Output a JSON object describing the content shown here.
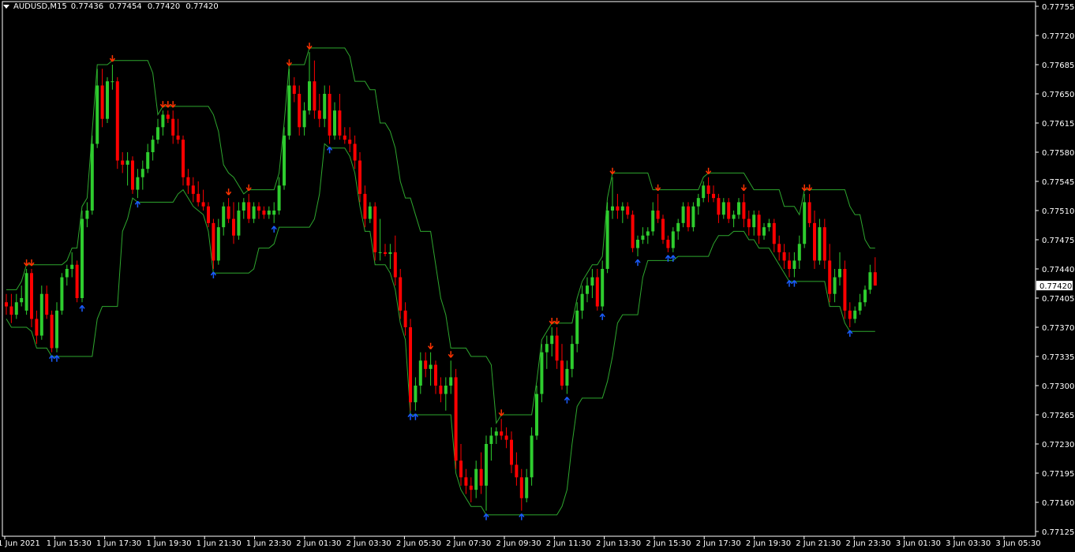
{
  "header": {
    "symbol": "AUDUSD,M15",
    "open": "0.77436",
    "high": "0.77454",
    "low": "0.77420",
    "close": "0.77420"
  },
  "current_price_label": "0.77420",
  "colors": {
    "background": "#000000",
    "bull": "#2ecc2e",
    "bear": "#ff0000",
    "envelope": "#2ea62e",
    "arrow_up": "#1a5cff",
    "arrow_down": "#ff3300",
    "price_tag_bg": "#ffffff",
    "axis": "#ffffff"
  },
  "chart_data": {
    "type": "candlestick",
    "ylim": [
      0.77125,
      0.77755
    ],
    "y_ticks": [
      "0.77755",
      "0.77720",
      "0.77685",
      "0.77650",
      "0.77615",
      "0.77580",
      "0.77545",
      "0.77510",
      "0.77475",
      "0.77440",
      "0.77405",
      "0.77370",
      "0.77335",
      "0.77300",
      "0.77265",
      "0.77230",
      "0.77195",
      "0.77160",
      "0.77125"
    ],
    "x_ticks": [
      "1 Jun 2021",
      "1 Jun 15:30",
      "1 Jun 17:30",
      "1 Jun 19:30",
      "1 Jun 21:30",
      "1 Jun 23:30",
      "2 Jun 01:30",
      "2 Jun 03:30",
      "2 Jun 05:30",
      "2 Jun 07:30",
      "2 Jun 09:30",
      "2 Jun 11:30",
      "2 Jun 13:30",
      "2 Jun 15:30",
      "2 Jun 17:30",
      "2 Jun 19:30",
      "2 Jun 21:30",
      "2 Jun 23:30",
      "3 Jun 01:30",
      "3 Jun 03:30",
      "3 Jun 05:30"
    ],
    "candle_step": 6.4,
    "candles": [
      [
        0.774,
        0.7741,
        0.77385,
        0.77395
      ],
      [
        0.77395,
        0.7741,
        0.77375,
        0.77385
      ],
      [
        0.77385,
        0.7741,
        0.7738,
        0.774
      ],
      [
        0.774,
        0.7742,
        0.77395,
        0.77405
      ],
      [
        0.7739,
        0.7744,
        0.77385,
        0.77435
      ],
      [
        0.77435,
        0.7744,
        0.7737,
        0.7738
      ],
      [
        0.7738,
        0.7739,
        0.7735,
        0.7736
      ],
      [
        0.7736,
        0.7742,
        0.77355,
        0.7741
      ],
      [
        0.7741,
        0.7742,
        0.7738,
        0.77385
      ],
      [
        0.77385,
        0.7739,
        0.7734,
        0.77345
      ],
      [
        0.77345,
        0.774,
        0.7734,
        0.7739
      ],
      [
        0.7739,
        0.77435,
        0.77385,
        0.7743
      ],
      [
        0.7743,
        0.77445,
        0.7742,
        0.7744
      ],
      [
        0.7744,
        0.7746,
        0.7743,
        0.77445
      ],
      [
        0.77445,
        0.7745,
        0.774,
        0.77405
      ],
      [
        0.77405,
        0.7751,
        0.774,
        0.775
      ],
      [
        0.775,
        0.7752,
        0.7749,
        0.7751
      ],
      [
        0.7751,
        0.776,
        0.77505,
        0.7759
      ],
      [
        0.7759,
        0.7768,
        0.77585,
        0.7766
      ],
      [
        0.7766,
        0.7768,
        0.7761,
        0.7762
      ],
      [
        0.7762,
        0.7767,
        0.77615,
        0.77665
      ],
      [
        0.77665,
        0.77685,
        0.77655,
        0.77665
      ],
      [
        0.77665,
        0.7767,
        0.7756,
        0.7757
      ],
      [
        0.7757,
        0.7758,
        0.77555,
        0.77565
      ],
      [
        0.77565,
        0.7758,
        0.7754,
        0.7757
      ],
      [
        0.7757,
        0.77575,
        0.7753,
        0.77535
      ],
      [
        0.77535,
        0.7756,
        0.77525,
        0.7755
      ],
      [
        0.7755,
        0.7757,
        0.77535,
        0.7756
      ],
      [
        0.7756,
        0.7759,
        0.77555,
        0.7758
      ],
      [
        0.7758,
        0.776,
        0.7757,
        0.77595
      ],
      [
        0.77595,
        0.7762,
        0.7759,
        0.7761
      ],
      [
        0.7761,
        0.7763,
        0.776,
        0.77625
      ],
      [
        0.77625,
        0.7763,
        0.77615,
        0.7762
      ],
      [
        0.7762,
        0.7763,
        0.7759,
        0.776
      ],
      [
        0.776,
        0.7762,
        0.7759,
        0.77595
      ],
      [
        0.77595,
        0.776,
        0.7754,
        0.7755
      ],
      [
        0.7755,
        0.7756,
        0.7753,
        0.7754
      ],
      [
        0.7754,
        0.7755,
        0.7752,
        0.7753
      ],
      [
        0.7753,
        0.77545,
        0.77515,
        0.7752
      ],
      [
        0.7752,
        0.77535,
        0.7751,
        0.77515
      ],
      [
        0.77515,
        0.7752,
        0.7749,
        0.77495
      ],
      [
        0.77495,
        0.775,
        0.7744,
        0.7745
      ],
      [
        0.7745,
        0.775,
        0.77445,
        0.7749
      ],
      [
        0.7749,
        0.7752,
        0.7748,
        0.77515
      ],
      [
        0.77515,
        0.77525,
        0.77495,
        0.775
      ],
      [
        0.775,
        0.7752,
        0.7747,
        0.7748
      ],
      [
        0.7748,
        0.7752,
        0.77475,
        0.7751
      ],
      [
        0.7751,
        0.77525,
        0.775,
        0.7752
      ],
      [
        0.7752,
        0.7753,
        0.77495,
        0.775
      ],
      [
        0.775,
        0.7752,
        0.77495,
        0.77515
      ],
      [
        0.77515,
        0.7752,
        0.775,
        0.7751
      ],
      [
        0.7751,
        0.77515,
        0.775,
        0.77505
      ],
      [
        0.77505,
        0.77515,
        0.775,
        0.7751
      ],
      [
        0.77505,
        0.7752,
        0.77495,
        0.7751
      ],
      [
        0.7751,
        0.7755,
        0.77505,
        0.7754
      ],
      [
        0.7754,
        0.7761,
        0.77535,
        0.776
      ],
      [
        0.776,
        0.7768,
        0.77595,
        0.7766
      ],
      [
        0.7766,
        0.7767,
        0.7764,
        0.7765
      ],
      [
        0.7765,
        0.7766,
        0.776,
        0.7761
      ],
      [
        0.7761,
        0.7764,
        0.776,
        0.7763
      ],
      [
        0.7763,
        0.777,
        0.77625,
        0.77665
      ],
      [
        0.77665,
        0.7769,
        0.7762,
        0.7763
      ],
      [
        0.7763,
        0.7765,
        0.7761,
        0.7762
      ],
      [
        0.7762,
        0.7766,
        0.7761,
        0.7765
      ],
      [
        0.7765,
        0.7766,
        0.7759,
        0.776
      ],
      [
        0.776,
        0.7764,
        0.77595,
        0.7763
      ],
      [
        0.7763,
        0.7765,
        0.77595,
        0.776
      ],
      [
        0.776,
        0.7761,
        0.7759,
        0.77595
      ],
      [
        0.77595,
        0.7761,
        0.7758,
        0.7759
      ],
      [
        0.7759,
        0.776,
        0.7756,
        0.7757
      ],
      [
        0.7757,
        0.7758,
        0.7752,
        0.7753
      ],
      [
        0.7753,
        0.7754,
        0.7749,
        0.775
      ],
      [
        0.775,
        0.7752,
        0.77495,
        0.77515
      ],
      [
        0.77515,
        0.7752,
        0.7745,
        0.7746
      ],
      [
        0.7746,
        0.775,
        0.7745,
        0.7746
      ],
      [
        0.7746,
        0.7747,
        0.77455,
        0.77458
      ],
      [
        0.77458,
        0.7747,
        0.7744,
        0.7746
      ],
      [
        0.7746,
        0.7748,
        0.7742,
        0.7743
      ],
      [
        0.7743,
        0.7744,
        0.7738,
        0.7739
      ],
      [
        0.7739,
        0.774,
        0.7736,
        0.7737
      ],
      [
        0.7737,
        0.7738,
        0.7727,
        0.7728
      ],
      [
        0.7728,
        0.7731,
        0.7727,
        0.773
      ],
      [
        0.773,
        0.7734,
        0.7729,
        0.7733
      ],
      [
        0.7733,
        0.7734,
        0.7731,
        0.7732
      ],
      [
        0.7732,
        0.7734,
        0.773,
        0.77325
      ],
      [
        0.77325,
        0.7733,
        0.7729,
        0.773
      ],
      [
        0.773,
        0.7731,
        0.7728,
        0.7729
      ],
      [
        0.7729,
        0.7731,
        0.7727,
        0.773
      ],
      [
        0.773,
        0.7733,
        0.7729,
        0.7731
      ],
      [
        0.7731,
        0.7732,
        0.772,
        0.7721
      ],
      [
        0.7721,
        0.7723,
        0.7718,
        0.7719
      ],
      [
        0.7719,
        0.772,
        0.7717,
        0.7718
      ],
      [
        0.7718,
        0.7719,
        0.7716,
        0.77175
      ],
      [
        0.77175,
        0.7721,
        0.77165,
        0.772
      ],
      [
        0.772,
        0.7722,
        0.7717,
        0.7718
      ],
      [
        0.7718,
        0.7724,
        0.7715,
        0.7723
      ],
      [
        0.7723,
        0.7725,
        0.7721,
        0.7724
      ],
      [
        0.7724,
        0.7725,
        0.7723,
        0.77245
      ],
      [
        0.77245,
        0.7726,
        0.77235,
        0.7724
      ],
      [
        0.7724,
        0.7725,
        0.77225,
        0.77235
      ],
      [
        0.77235,
        0.77245,
        0.77195,
        0.77205
      ],
      [
        0.77205,
        0.7722,
        0.7718,
        0.7719
      ],
      [
        0.7719,
        0.772,
        0.7715,
        0.77165
      ],
      [
        0.77165,
        0.772,
        0.7716,
        0.7719
      ],
      [
        0.7719,
        0.7725,
        0.7718,
        0.7724
      ],
      [
        0.7724,
        0.773,
        0.77235,
        0.7729
      ],
      [
        0.7729,
        0.7735,
        0.7728,
        0.7734
      ],
      [
        0.7734,
        0.7736,
        0.7732,
        0.7735
      ],
      [
        0.7735,
        0.7737,
        0.77335,
        0.7736
      ],
      [
        0.7736,
        0.7737,
        0.7732,
        0.7733
      ],
      [
        0.7733,
        0.7735,
        0.77295,
        0.773
      ],
      [
        0.773,
        0.7733,
        0.7729,
        0.7732
      ],
      [
        0.7732,
        0.7736,
        0.7731,
        0.7735
      ],
      [
        0.7735,
        0.774,
        0.7734,
        0.7739
      ],
      [
        0.7739,
        0.7742,
        0.7738,
        0.7741
      ],
      [
        0.7741,
        0.7743,
        0.774,
        0.7742
      ],
      [
        0.7742,
        0.7744,
        0.77405,
        0.7743
      ],
      [
        0.7743,
        0.7744,
        0.7739,
        0.77395
      ],
      [
        0.77395,
        0.7745,
        0.7739,
        0.7744
      ],
      [
        0.7744,
        0.7752,
        0.77435,
        0.7751
      ],
      [
        0.7751,
        0.7755,
        0.775,
        0.77515
      ],
      [
        0.77515,
        0.7753,
        0.775,
        0.7751
      ],
      [
        0.7751,
        0.7752,
        0.77495,
        0.77515
      ],
      [
        0.77515,
        0.7752,
        0.775,
        0.77505
      ],
      [
        0.77505,
        0.7751,
        0.7746,
        0.77465
      ],
      [
        0.77465,
        0.7748,
        0.77455,
        0.77475
      ],
      [
        0.77475,
        0.7749,
        0.7747,
        0.7748
      ],
      [
        0.7748,
        0.7749,
        0.7747,
        0.77485
      ],
      [
        0.77485,
        0.7752,
        0.7748,
        0.7751
      ],
      [
        0.7751,
        0.7753,
        0.77495,
        0.775
      ],
      [
        0.775,
        0.77505,
        0.7747,
        0.77475
      ],
      [
        0.77475,
        0.7748,
        0.7746,
        0.77465
      ],
      [
        0.77465,
        0.7749,
        0.7746,
        0.77485
      ],
      [
        0.77485,
        0.775,
        0.77475,
        0.77495
      ],
      [
        0.77495,
        0.7752,
        0.7749,
        0.77515
      ],
      [
        0.77515,
        0.7752,
        0.77485,
        0.7749
      ],
      [
        0.7749,
        0.7752,
        0.77485,
        0.77515
      ],
      [
        0.77515,
        0.7753,
        0.77505,
        0.77525
      ],
      [
        0.77525,
        0.77545,
        0.7752,
        0.7754
      ],
      [
        0.7754,
        0.7755,
        0.7752,
        0.7753
      ],
      [
        0.7753,
        0.7754,
        0.7752,
        0.77525
      ],
      [
        0.77525,
        0.7753,
        0.77495,
        0.77505
      ],
      [
        0.77505,
        0.77525,
        0.775,
        0.7752
      ],
      [
        0.7752,
        0.77525,
        0.77495,
        0.775
      ],
      [
        0.775,
        0.7751,
        0.7749,
        0.77505
      ],
      [
        0.77505,
        0.77525,
        0.775,
        0.7752
      ],
      [
        0.7752,
        0.7753,
        0.7749,
        0.775
      ],
      [
        0.775,
        0.7751,
        0.7748,
        0.7749
      ],
      [
        0.7749,
        0.7751,
        0.7748,
        0.77505
      ],
      [
        0.77505,
        0.7751,
        0.7747,
        0.7748
      ],
      [
        0.7748,
        0.77495,
        0.77475,
        0.7749
      ],
      [
        0.7749,
        0.775,
        0.77485,
        0.77495
      ],
      [
        0.77495,
        0.775,
        0.7746,
        0.7747
      ],
      [
        0.7747,
        0.7748,
        0.7745,
        0.7746
      ],
      [
        0.7746,
        0.7747,
        0.7744,
        0.7745
      ],
      [
        0.7745,
        0.7746,
        0.7743,
        0.7744
      ],
      [
        0.7744,
        0.7746,
        0.7743,
        0.7745
      ],
      [
        0.7745,
        0.7748,
        0.7744,
        0.7747
      ],
      [
        0.7747,
        0.7753,
        0.77465,
        0.7752
      ],
      [
        0.7752,
        0.7753,
        0.7749,
        0.77495
      ],
      [
        0.77495,
        0.7751,
        0.7744,
        0.7745
      ],
      [
        0.7745,
        0.775,
        0.77445,
        0.7749
      ],
      [
        0.7749,
        0.775,
        0.7744,
        0.7745
      ],
      [
        0.7745,
        0.7747,
        0.774,
        0.7741
      ],
      [
        0.7741,
        0.7744,
        0.774,
        0.7743
      ],
      [
        0.7743,
        0.7746,
        0.7742,
        0.7744
      ],
      [
        0.7744,
        0.7745,
        0.7738,
        0.7739
      ],
      [
        0.7739,
        0.774,
        0.7737,
        0.7738
      ],
      [
        0.7738,
        0.77395,
        0.77375,
        0.7739
      ],
      [
        0.7739,
        0.7741,
        0.77385,
        0.774
      ],
      [
        0.774,
        0.7742,
        0.77395,
        0.77415
      ],
      [
        0.77415,
        0.77445,
        0.7741,
        0.77436
      ],
      [
        0.77436,
        0.77454,
        0.7742,
        0.7742
      ]
    ]
  }
}
